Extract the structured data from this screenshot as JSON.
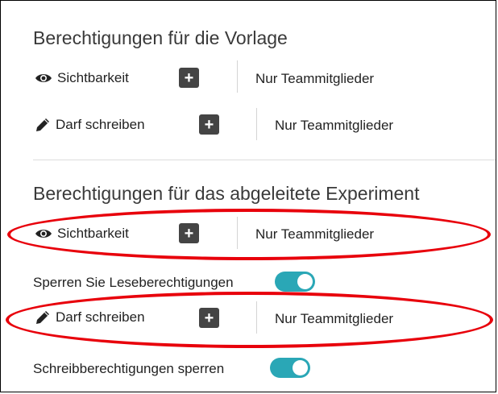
{
  "template_section": {
    "heading": "Berechtigungen für die Vorlage",
    "visibility": {
      "label": "Sichtbarkeit",
      "add_symbol": "+",
      "value": "Nur Teammitglieder"
    },
    "write": {
      "label": "Darf schreiben",
      "add_symbol": "+",
      "value": "Nur Teammitglieder"
    }
  },
  "experiment_section": {
    "heading": "Berechtigungen für das abgeleitete Experiment",
    "visibility": {
      "label": "Sichtbarkeit",
      "add_symbol": "+",
      "value": "Nur Teammitglieder"
    },
    "lock_read": {
      "label": "Sperren Sie Leseberechtigungen",
      "enabled": true
    },
    "write": {
      "label": "Darf schreiben",
      "add_symbol": "+",
      "value": "Nur Teammitglieder"
    },
    "lock_write": {
      "label": "Schreibberechtigungen sperren",
      "enabled": true
    }
  },
  "icons": {
    "visibility": "eye-icon",
    "write": "pencil-icon"
  },
  "colors": {
    "toggle_on": "#2aa7b6",
    "highlight": "#e8000b",
    "button_bg": "#444444"
  }
}
